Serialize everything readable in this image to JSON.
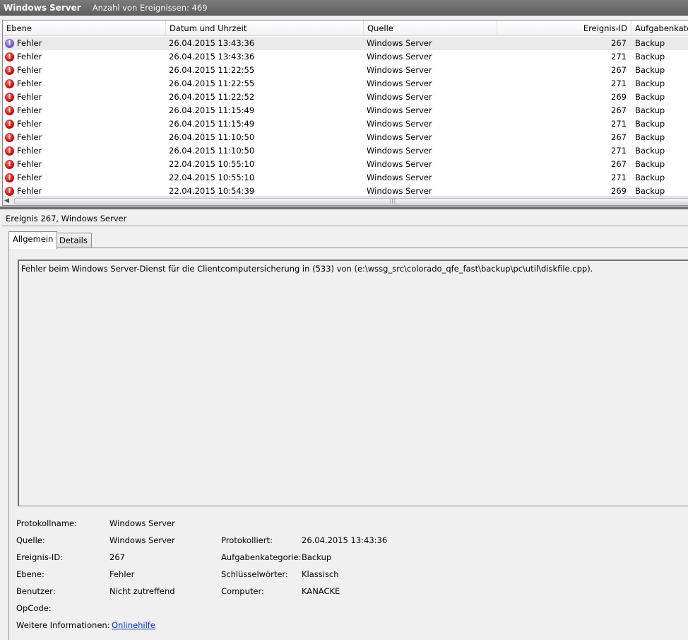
{
  "titlebar": {
    "app_name": "Windows Server",
    "event_count": "Anzahl von Ereignissen: 469"
  },
  "list": {
    "columns": [
      "Ebene",
      "Datum und Uhrzeit",
      "Quelle",
      "Ereignis-ID",
      "Aufgabenkate"
    ],
    "rows": [
      {
        "level": "Fehler",
        "date": "26.04.2015 13:43:36",
        "source": "Windows Server",
        "id": "267",
        "category": "Backup"
      },
      {
        "level": "Fehler",
        "date": "26.04.2015 13:43:36",
        "source": "Windows Server",
        "id": "271",
        "category": "Backup"
      },
      {
        "level": "Fehler",
        "date": "26.04.2015 11:22:55",
        "source": "Windows Server",
        "id": "267",
        "category": "Backup"
      },
      {
        "level": "Fehler",
        "date": "26.04.2015 11:22:55",
        "source": "Windows Server",
        "id": "271",
        "category": "Backup"
      },
      {
        "level": "Fehler",
        "date": "26.04.2015 11:22:52",
        "source": "Windows Server",
        "id": "269",
        "category": "Backup"
      },
      {
        "level": "Fehler",
        "date": "26.04.2015 11:15:49",
        "source": "Windows Server",
        "id": "267",
        "category": "Backup"
      },
      {
        "level": "Fehler",
        "date": "26.04.2015 11:15:49",
        "source": "Windows Server",
        "id": "271",
        "category": "Backup"
      },
      {
        "level": "Fehler",
        "date": "26.04.2015 11:10:50",
        "source": "Windows Server",
        "id": "267",
        "category": "Backup"
      },
      {
        "level": "Fehler",
        "date": "26.04.2015 11:10:50",
        "source": "Windows Server",
        "id": "271",
        "category": "Backup"
      },
      {
        "level": "Fehler",
        "date": "22.04.2015 10:55:10",
        "source": "Windows Server",
        "id": "267",
        "category": "Backup"
      },
      {
        "level": "Fehler",
        "date": "22.04.2015 10:55:10",
        "source": "Windows Server",
        "id": "271",
        "category": "Backup"
      },
      {
        "level": "Fehler",
        "date": "22.04.2015 10:54:39",
        "source": "Windows Server",
        "id": "269",
        "category": "Backup"
      }
    ],
    "selected_index": 0,
    "error_glyph": "!"
  },
  "detail": {
    "header": "Ereignis 267, Windows Server",
    "tabs": [
      "Allgemein",
      "Details"
    ],
    "active_tab": "Allgemein",
    "message": "Fehler beim Windows Server-Dienst für die Clientcomputersicherung in (533) von (e:\\wssg_src\\colorado_qfe_fast\\backup\\pc\\util\\diskfile.cpp).",
    "props": {
      "protokollname_label": "Protokollname:",
      "protokollname_value": "Windows Server",
      "quelle_label": "Quelle:",
      "quelle_value": "Windows Server",
      "protokolliert_label": "Protokolliert:",
      "protokolliert_value": "26.04.2015 13:43:36",
      "ereignisid_label": "Ereignis-ID:",
      "ereignisid_value": "267",
      "aufgabenkategorie_label": "Aufgabenkategorie:",
      "aufgabenkategorie_value": "Backup",
      "ebene_label": "Ebene:",
      "ebene_value": "Fehler",
      "schluesselwoerter_label": "Schlüsselwörter:",
      "schluesselwoerter_value": "Klassisch",
      "benutzer_label": "Benutzer:",
      "benutzer_value": "Nicht zutreffend",
      "computer_label": "Computer:",
      "computer_value": "KANACKE",
      "opcode_label": "OpCode:",
      "weitere_label": "Weitere Informationen:",
      "weitere_link": "Onlinehilfe"
    }
  },
  "colors": {
    "titlebar": "#6a6a6a",
    "error_icon": "#d10000",
    "link": "#0033cc"
  }
}
